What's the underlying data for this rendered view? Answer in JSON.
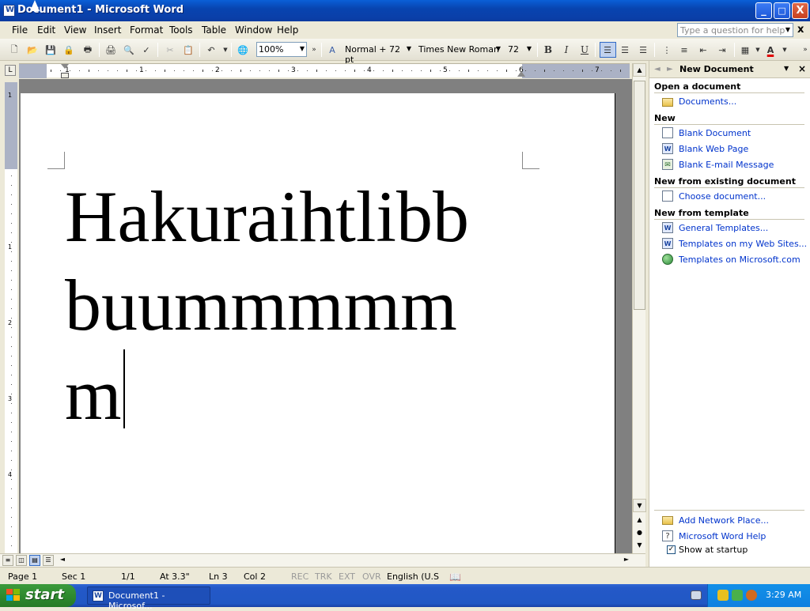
{
  "window": {
    "title": "Document1 - Microsoft Word",
    "controls": {
      "minimize": "_",
      "maximize": "□",
      "close": "X"
    }
  },
  "menu": {
    "items": [
      "File",
      "Edit",
      "View",
      "Insert",
      "Format",
      "Tools",
      "Table",
      "Window",
      "Help"
    ],
    "help_placeholder": "Type a question for help",
    "doc_close": "x"
  },
  "toolbar": {
    "zoom": "100%",
    "style": "Normal + 72 pt",
    "font": "Times New Roman",
    "size": "72",
    "bold": "B",
    "italic": "I",
    "underline": "U"
  },
  "ruler": {
    "numbers": [
      "1",
      "1",
      "2",
      "3",
      "4",
      "5",
      "6",
      "7"
    ],
    "vnumbers": [
      "1",
      "1",
      "2",
      "3",
      "4"
    ],
    "tab_button": "L"
  },
  "document": {
    "lines": [
      "Hakuraihtlibb",
      "buummmmm",
      "m"
    ]
  },
  "taskpane": {
    "title": "New Document",
    "sections": {
      "open": "Open a document",
      "new": "New",
      "existing": "New from existing document",
      "template": "New from template"
    },
    "links": {
      "documents": "Documents...",
      "blank_document": "Blank Document",
      "blank_web_page": "Blank Web Page",
      "blank_email": "Blank E-mail Message",
      "choose_document": "Choose document...",
      "general_templates": "General Templates...",
      "templates_web_sites": "Templates on my Web Sites...",
      "templates_microsoft": "Templates on Microsoft.com",
      "add_network_place": "Add Network Place...",
      "word_help": "Microsoft Word Help"
    },
    "show_at_startup": "Show at startup"
  },
  "status": {
    "page": "Page 1",
    "sec": "Sec 1",
    "pages": "1/1",
    "at": "At 3.3\"",
    "ln": "Ln 3",
    "col": "Col 2",
    "rec": "REC",
    "trk": "TRK",
    "ext": "EXT",
    "ovr": "OVR",
    "language": "English (U.S"
  },
  "taskbar": {
    "start": "start",
    "task": "Document1 - Microsof...",
    "clock": "3:29 AM"
  },
  "colors": {
    "title_blue": "#0a5fd8",
    "taskbar_blue": "#2459c8",
    "start_green": "#2f8a2f",
    "link_blue": "#0033cc",
    "font_color_red": "#e00000"
  }
}
